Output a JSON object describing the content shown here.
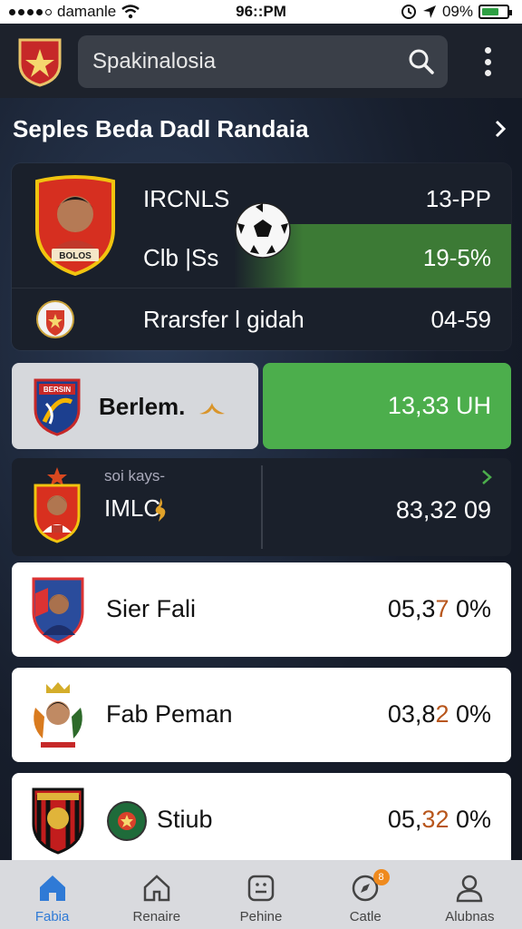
{
  "status_bar": {
    "carrier": "damanle",
    "time": "96::PM",
    "battery": "09%"
  },
  "app_bar": {
    "search_value": "Spakinalosia"
  },
  "section": {
    "title": "Seples Beda Dadl Randaia"
  },
  "featured": {
    "badge_text": "BOLOS",
    "rows": [
      {
        "label": "IRCNLS",
        "value": "13-PP"
      },
      {
        "label": "Clb |Ss",
        "value": "19-5%"
      },
      {
        "label": "Rrarsfer l gidah",
        "value": "04-59"
      }
    ]
  },
  "club_row": {
    "name": "Berlem.",
    "crest_text": "BERSIN",
    "value": "13,33 UH"
  },
  "transfer_row": {
    "sub": "soi kays-",
    "name": "IMLC",
    "value": "83,32 09"
  },
  "players": [
    {
      "name": "Sier Fali",
      "value_main": "05,3",
      "value_accent": "7",
      "value_tail": " 0%"
    },
    {
      "name": "Fab Peman",
      "value_main": "03,8",
      "value_accent": "2",
      "value_tail": " 0%"
    },
    {
      "name": "Stiub",
      "value_main": "05,",
      "value_accent": "32",
      "value_tail": " 0%"
    }
  ],
  "bottom_nav": [
    {
      "label": "Fabia",
      "icon": "home-icon",
      "active": true
    },
    {
      "label": "Renaire",
      "icon": "house-outline-icon"
    },
    {
      "label": "Pehine",
      "icon": "grid-icon"
    },
    {
      "label": "Catle",
      "icon": "compass-icon",
      "badge": "8"
    },
    {
      "label": "Alubnas",
      "icon": "user-icon"
    }
  ],
  "colors": {
    "accent_green": "#4cae4c",
    "active_blue": "#2f7ad6",
    "value_accent": "#b8561c"
  }
}
